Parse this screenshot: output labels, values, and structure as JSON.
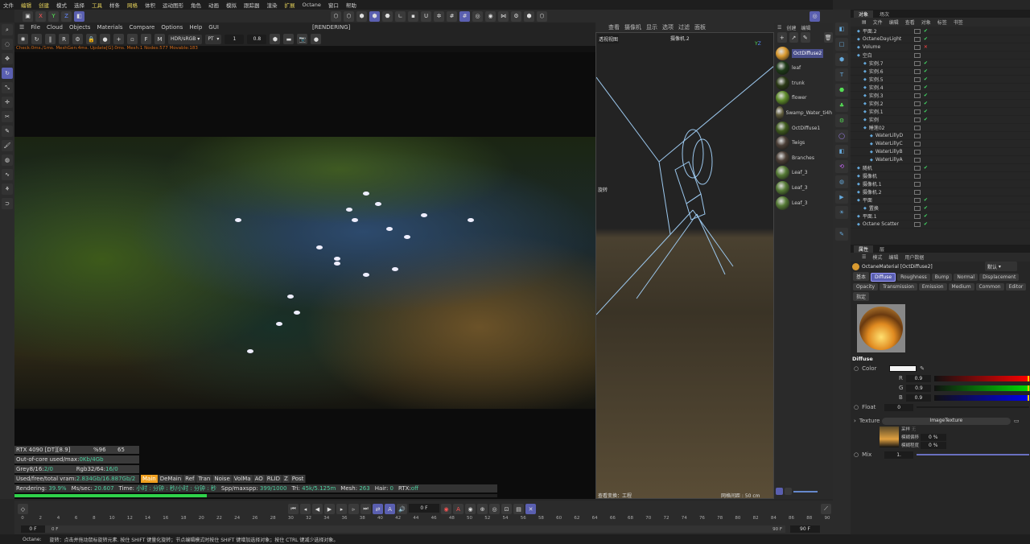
{
  "menubar": [
    "文件",
    "编辑",
    "创建",
    "模式",
    "选择",
    "工具",
    "样条",
    "网格",
    "体积",
    "运动图形",
    "角色",
    "动画",
    "模拟",
    "跟踪器",
    "渲染",
    "扩展",
    "Octane",
    "窗口",
    "帮助"
  ],
  "axes": [
    "X",
    "Y",
    "Z"
  ],
  "octane": {
    "menu": [
      "File",
      "Cloud",
      "Objects",
      "Materials",
      "Compare",
      "Options",
      "Help",
      "GUI"
    ],
    "status": "[RENDERING]",
    "colorspace": "HDR/sRGB",
    "kernel": "PT",
    "value1": "1",
    "value2": "0.8",
    "checkline": "Check:0ms./1ms. MeshGen:4ms. Update[G]:0ms. Mesh:1 Nodes:577 Movable:183",
    "gpu": "RTX 4090 [DT][8.9]",
    "gpu_pct": "%96",
    "gpu_temp": "65",
    "outofcore_label": "Out-of-core used/max:",
    "outofcore_value": "0Kb/4Gb",
    "grey_label": "Grey8/16: ",
    "grey_value": "2/0",
    "rgb_label": "Rgb32/64: ",
    "rgb_value": "16/0",
    "vram_label": "Used/free/total vram: ",
    "vram_value": "2.834Gb/16.887Gb/2",
    "passes": [
      "Main",
      "DeMain",
      "Ref",
      "Tran",
      "Noise",
      "VolMa",
      "AO",
      "RLID",
      "Z",
      "Post"
    ],
    "rendering_label": "Rendering: ",
    "rendering_value": "39.9%",
    "ms_label": "Ms/sec: ",
    "ms_value": "20.607",
    "time_label": "Time: ",
    "time_value": "小时 : 分钟 : 秒/小时 : 分钟 : 秒",
    "spp_label": "Spp/maxspp: ",
    "spp_value": "399/1000",
    "tri_label": "Tri: ",
    "tri_value": "45k/5.125m",
    "mesh_label": "Mesh: ",
    "mesh_value": "263",
    "hair_label": "Hair: ",
    "hair_value": "0",
    "rtx_label": "RTX:",
    "rtx_value": "off",
    "progress": 39.9,
    "progress_color": "#2fd24a"
  },
  "viewport": {
    "menu": [
      "查看",
      "摄像机",
      "显示",
      "选项",
      "过滤",
      "面板"
    ],
    "view_name": "透视视图",
    "camera": "摄像机.2",
    "rotate_label": "旋转",
    "bottom_left": "查看变换：工程",
    "bottom_right": "网格间距 : 50 cm"
  },
  "materials": {
    "menu": [
      "创建",
      "编辑"
    ],
    "items": [
      {
        "name": "OctDiffuse2",
        "color": "#d99a30",
        "selected": true
      },
      {
        "name": "leaf",
        "color": "#1e3a18"
      },
      {
        "name": "trunk",
        "color": "#2b3a16"
      },
      {
        "name": "flower",
        "color": "#5e8a2a"
      },
      {
        "name": "Swamp_Water_ti4h",
        "color": "#5e5a3a"
      },
      {
        "name": "OctDiffuse1",
        "color": "#3f5a1e"
      },
      {
        "name": "Twigs",
        "color": "#4a3e36"
      },
      {
        "name": "Branches",
        "color": "#4a3e36"
      },
      {
        "name": "Leaf_3",
        "color": "#557a35"
      },
      {
        "name": "Leaf_3",
        "color": "#557a35"
      },
      {
        "name": "Leaf_3",
        "color": "#557a35"
      }
    ]
  },
  "objects": {
    "tabs": [
      "对象",
      "场次"
    ],
    "menu": [
      "文件",
      "编辑",
      "查看",
      "对象",
      "标签",
      "书签"
    ],
    "rows": [
      {
        "name": "平面.2",
        "state": "check"
      },
      {
        "name": "OctaneDayLight",
        "state": "check"
      },
      {
        "name": "Volume",
        "state": "cross"
      },
      {
        "name": "空白",
        "state": ""
      },
      {
        "name": "实例.7",
        "state": "check"
      },
      {
        "name": "实例.6",
        "state": "check"
      },
      {
        "name": "实例.5",
        "state": "check"
      },
      {
        "name": "实例.4",
        "state": "check"
      },
      {
        "name": "实例.3",
        "state": "check"
      },
      {
        "name": "实例.2",
        "state": "check"
      },
      {
        "name": "实例.1",
        "state": "check"
      },
      {
        "name": "实例",
        "state": "check"
      },
      {
        "name": "睡莲02",
        "state": ""
      },
      {
        "name": "WaterLillyD",
        "state": ""
      },
      {
        "name": "WaterLillyC",
        "state": ""
      },
      {
        "name": "WaterLillyB",
        "state": ""
      },
      {
        "name": "WaterLillyA",
        "state": ""
      },
      {
        "name": "随机",
        "state": "check"
      },
      {
        "name": "摄像机",
        "state": ""
      },
      {
        "name": "摄像机.1",
        "state": ""
      },
      {
        "name": "摄像机.2",
        "state": ""
      },
      {
        "name": "平面",
        "state": "check"
      },
      {
        "name": "置换",
        "state": "check"
      },
      {
        "name": "平面.1",
        "state": "check"
      },
      {
        "name": "Octane Scatter",
        "state": "check"
      }
    ]
  },
  "attributes": {
    "tabs": [
      "属性",
      "层"
    ],
    "menu": [
      "模式",
      "编辑",
      "用户数据"
    ],
    "title": "OctaneMaterial [OctDiffuse2]",
    "preset": "默认",
    "buttons": [
      "基本",
      "Diffuse",
      "Roughness",
      "Bump",
      "Normal",
      "Displacement",
      "Opacity",
      "Transmission",
      "Emission",
      "Medium",
      "Common",
      "Editor",
      "指定"
    ],
    "active_button": "Diffuse",
    "section": "Diffuse",
    "color_label": "Color",
    "r_label": "R",
    "g_label": "G",
    "b_label": "B",
    "r": "0.9",
    "g": "0.9",
    "b": "0.9",
    "float_label": "Float",
    "float_value": "0",
    "texture_label": "Texture",
    "texture_name": "ImageTexture",
    "sample_label": "采样",
    "sample_value": "无",
    "blur_offset_label": "模糊偏移",
    "blur_offset": "0 %",
    "blur_scale_label": "模糊程度",
    "blur_scale": "0 %",
    "mix_label": "Mix",
    "mix_value": "1."
  },
  "timeline": {
    "current": "0 F",
    "start": "0 F",
    "start2": "0 F",
    "end": "90 F",
    "end2": "90 F",
    "max": 90,
    "step": 2
  },
  "statusbar": {
    "app": "Octane:",
    "message": "旋转：点击并拖动鼠标旋转元素. 按住 SHIFT 键量化旋转；节点编辑模式时按住 SHIFT 键增加选择对象；按住 CTRL 键减少选择对象。"
  }
}
